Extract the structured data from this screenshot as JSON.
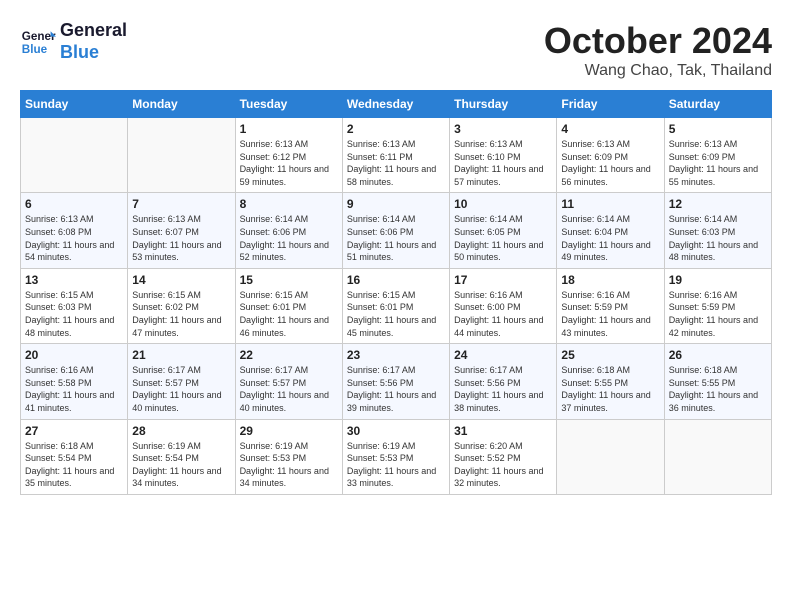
{
  "header": {
    "logo_line1": "General",
    "logo_line2": "Blue",
    "month": "October 2024",
    "location": "Wang Chao, Tak, Thailand"
  },
  "days_of_week": [
    "Sunday",
    "Monday",
    "Tuesday",
    "Wednesday",
    "Thursday",
    "Friday",
    "Saturday"
  ],
  "weeks": [
    [
      {
        "day": "",
        "content": ""
      },
      {
        "day": "",
        "content": ""
      },
      {
        "day": "1",
        "content": "Sunrise: 6:13 AM\nSunset: 6:12 PM\nDaylight: 11 hours and 59 minutes."
      },
      {
        "day": "2",
        "content": "Sunrise: 6:13 AM\nSunset: 6:11 PM\nDaylight: 11 hours and 58 minutes."
      },
      {
        "day": "3",
        "content": "Sunrise: 6:13 AM\nSunset: 6:10 PM\nDaylight: 11 hours and 57 minutes."
      },
      {
        "day": "4",
        "content": "Sunrise: 6:13 AM\nSunset: 6:09 PM\nDaylight: 11 hours and 56 minutes."
      },
      {
        "day": "5",
        "content": "Sunrise: 6:13 AM\nSunset: 6:09 PM\nDaylight: 11 hours and 55 minutes."
      }
    ],
    [
      {
        "day": "6",
        "content": "Sunrise: 6:13 AM\nSunset: 6:08 PM\nDaylight: 11 hours and 54 minutes."
      },
      {
        "day": "7",
        "content": "Sunrise: 6:13 AM\nSunset: 6:07 PM\nDaylight: 11 hours and 53 minutes."
      },
      {
        "day": "8",
        "content": "Sunrise: 6:14 AM\nSunset: 6:06 PM\nDaylight: 11 hours and 52 minutes."
      },
      {
        "day": "9",
        "content": "Sunrise: 6:14 AM\nSunset: 6:06 PM\nDaylight: 11 hours and 51 minutes."
      },
      {
        "day": "10",
        "content": "Sunrise: 6:14 AM\nSunset: 6:05 PM\nDaylight: 11 hours and 50 minutes."
      },
      {
        "day": "11",
        "content": "Sunrise: 6:14 AM\nSunset: 6:04 PM\nDaylight: 11 hours and 49 minutes."
      },
      {
        "day": "12",
        "content": "Sunrise: 6:14 AM\nSunset: 6:03 PM\nDaylight: 11 hours and 48 minutes."
      }
    ],
    [
      {
        "day": "13",
        "content": "Sunrise: 6:15 AM\nSunset: 6:03 PM\nDaylight: 11 hours and 48 minutes."
      },
      {
        "day": "14",
        "content": "Sunrise: 6:15 AM\nSunset: 6:02 PM\nDaylight: 11 hours and 47 minutes."
      },
      {
        "day": "15",
        "content": "Sunrise: 6:15 AM\nSunset: 6:01 PM\nDaylight: 11 hours and 46 minutes."
      },
      {
        "day": "16",
        "content": "Sunrise: 6:15 AM\nSunset: 6:01 PM\nDaylight: 11 hours and 45 minutes."
      },
      {
        "day": "17",
        "content": "Sunrise: 6:16 AM\nSunset: 6:00 PM\nDaylight: 11 hours and 44 minutes."
      },
      {
        "day": "18",
        "content": "Sunrise: 6:16 AM\nSunset: 5:59 PM\nDaylight: 11 hours and 43 minutes."
      },
      {
        "day": "19",
        "content": "Sunrise: 6:16 AM\nSunset: 5:59 PM\nDaylight: 11 hours and 42 minutes."
      }
    ],
    [
      {
        "day": "20",
        "content": "Sunrise: 6:16 AM\nSunset: 5:58 PM\nDaylight: 11 hours and 41 minutes."
      },
      {
        "day": "21",
        "content": "Sunrise: 6:17 AM\nSunset: 5:57 PM\nDaylight: 11 hours and 40 minutes."
      },
      {
        "day": "22",
        "content": "Sunrise: 6:17 AM\nSunset: 5:57 PM\nDaylight: 11 hours and 40 minutes."
      },
      {
        "day": "23",
        "content": "Sunrise: 6:17 AM\nSunset: 5:56 PM\nDaylight: 11 hours and 39 minutes."
      },
      {
        "day": "24",
        "content": "Sunrise: 6:17 AM\nSunset: 5:56 PM\nDaylight: 11 hours and 38 minutes."
      },
      {
        "day": "25",
        "content": "Sunrise: 6:18 AM\nSunset: 5:55 PM\nDaylight: 11 hours and 37 minutes."
      },
      {
        "day": "26",
        "content": "Sunrise: 6:18 AM\nSunset: 5:55 PM\nDaylight: 11 hours and 36 minutes."
      }
    ],
    [
      {
        "day": "27",
        "content": "Sunrise: 6:18 AM\nSunset: 5:54 PM\nDaylight: 11 hours and 35 minutes."
      },
      {
        "day": "28",
        "content": "Sunrise: 6:19 AM\nSunset: 5:54 PM\nDaylight: 11 hours and 34 minutes."
      },
      {
        "day": "29",
        "content": "Sunrise: 6:19 AM\nSunset: 5:53 PM\nDaylight: 11 hours and 34 minutes."
      },
      {
        "day": "30",
        "content": "Sunrise: 6:19 AM\nSunset: 5:53 PM\nDaylight: 11 hours and 33 minutes."
      },
      {
        "day": "31",
        "content": "Sunrise: 6:20 AM\nSunset: 5:52 PM\nDaylight: 11 hours and 32 minutes."
      },
      {
        "day": "",
        "content": ""
      },
      {
        "day": "",
        "content": ""
      }
    ]
  ]
}
